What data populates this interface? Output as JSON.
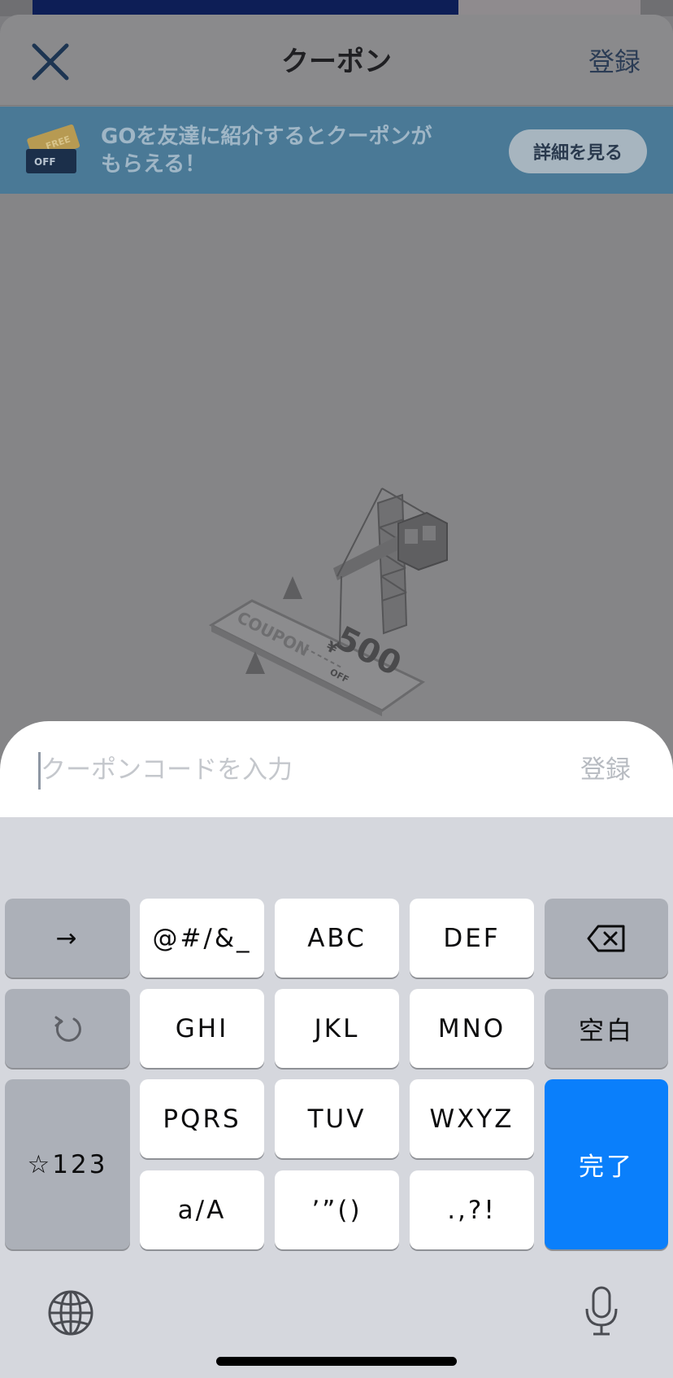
{
  "header": {
    "title": "クーポン",
    "register_label": "登録"
  },
  "promo": {
    "text_line1": "GOを友達に紹介するとクーポンが",
    "text_line2": "もらえる！",
    "button_label": "詳細を見る",
    "ticket_label": "OFF"
  },
  "illustration": {
    "coupon_word": "COUPON",
    "amount": "500",
    "off_word": "OFF",
    "currency_symbol": "¥"
  },
  "input": {
    "placeholder": "クーポンコードを入力",
    "value": "",
    "register_label": "登録"
  },
  "keyboard": {
    "row1": [
      "→",
      "@#/&_",
      "ABC",
      "DEF"
    ],
    "row2": [
      "GHI",
      "JKL",
      "MNO"
    ],
    "row3": [
      "PQRS",
      "TUV",
      "WXYZ"
    ],
    "row4": [
      "a/A",
      "’”()",
      ".,?!"
    ],
    "space_label": "空白",
    "numbers_label": "☆123",
    "done_label": "完了",
    "icons": [
      "backspace-icon",
      "undo-icon",
      "globe-icon",
      "microphone-icon"
    ]
  },
  "colors": {
    "accent": "#0a7ffb",
    "promo_bg": "#4a7996",
    "dim_overlay": "#858587",
    "keyboard_bg": "#d5d7dd"
  }
}
